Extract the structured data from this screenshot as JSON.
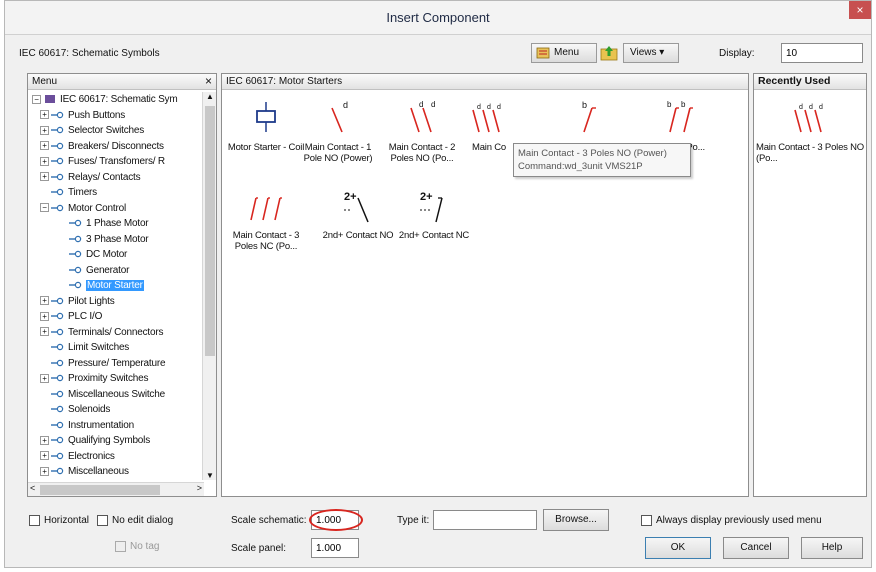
{
  "window": {
    "title": "Insert Component",
    "close_glyph": "×"
  },
  "toolbar": {
    "path": "IEC 60617: Schematic Symbols",
    "menu_label": "Menu",
    "views_label": "Views ▾",
    "display_label": "Display:",
    "display_value": "10"
  },
  "menu_panel": {
    "header": "Menu",
    "close_glyph": "×",
    "tree": [
      {
        "label": "IEC 60617: Schematic Sym",
        "level": 0,
        "expander": "−",
        "icon": "schematic-icon"
      },
      {
        "label": "Push Buttons",
        "level": 1,
        "expander": "+"
      },
      {
        "label": "Selector Switches",
        "level": 1,
        "expander": "+"
      },
      {
        "label": "Breakers/ Disconnects",
        "level": 1,
        "expander": "+"
      },
      {
        "label": "Fuses/ Transfomers/ R",
        "level": 1,
        "expander": "+"
      },
      {
        "label": "Relays/ Contacts",
        "level": 1,
        "expander": "+"
      },
      {
        "label": "Timers",
        "level": 1,
        "expander": ""
      },
      {
        "label": "Motor Control",
        "level": 1,
        "expander": "−"
      },
      {
        "label": "1 Phase Motor",
        "level": 2,
        "expander": ""
      },
      {
        "label": "3 Phase Motor",
        "level": 2,
        "expander": ""
      },
      {
        "label": "DC Motor",
        "level": 2,
        "expander": ""
      },
      {
        "label": "Generator",
        "level": 2,
        "expander": ""
      },
      {
        "label": "Motor Starter",
        "level": 2,
        "expander": "",
        "selected": true
      },
      {
        "label": "Pilot Lights",
        "level": 1,
        "expander": "+"
      },
      {
        "label": "PLC I/O",
        "level": 1,
        "expander": "+"
      },
      {
        "label": "Terminals/ Connectors",
        "level": 1,
        "expander": "+"
      },
      {
        "label": "Limit Switches",
        "level": 1,
        "expander": ""
      },
      {
        "label": "Pressure/ Temperature",
        "level": 1,
        "expander": ""
      },
      {
        "label": "Proximity Switches",
        "level": 1,
        "expander": "+"
      },
      {
        "label": "Miscellaneous Switche",
        "level": 1,
        "expander": ""
      },
      {
        "label": "Solenoids",
        "level": 1,
        "expander": ""
      },
      {
        "label": "Instrumentation",
        "level": 1,
        "expander": ""
      },
      {
        "label": "Qualifying Symbols",
        "level": 1,
        "expander": "+"
      },
      {
        "label": "Electronics",
        "level": 1,
        "expander": "+"
      },
      {
        "label": "Miscellaneous",
        "level": 1,
        "expander": "+"
      }
    ]
  },
  "components_panel": {
    "header": "IEC 60617: Motor Starters",
    "items": [
      {
        "caption": "Motor Starter - Coil",
        "icon": "coil"
      },
      {
        "caption": "Main Contact - 1 Pole NO (Power)",
        "icon": "no-1"
      },
      {
        "caption": "Main Contact - 2 Poles NO (Po...",
        "icon": "no-2"
      },
      {
        "caption": "Main Co",
        "icon": "no-3"
      },
      {
        "caption": "",
        "icon": "nc-1"
      },
      {
        "caption": "ct - 2 Po...",
        "icon": "nc-2"
      },
      {
        "caption": "Main Contact - 3 Poles NC (Po...",
        "icon": "nc-3"
      },
      {
        "caption": "2nd+ Contact NO",
        "icon": "second-no"
      },
      {
        "caption": "2nd+ Contact NC",
        "icon": "second-nc"
      }
    ],
    "tooltip": {
      "line1": "Main Contact - 3 Poles NO (Power)",
      "line2": "Command:wd_3unit VMS21P"
    }
  },
  "recent_panel": {
    "header": "Recently Used",
    "items": [
      {
        "caption": "Main Contact - 3 Poles NO (Po...",
        "icon": "no-3"
      }
    ]
  },
  "bottom": {
    "horizontal_label": "Horizontal",
    "no_edit_label": "No edit dialog",
    "no_tag_label": "No tag",
    "scale_schematic_label": "Scale schematic:",
    "scale_schematic_value": "1.000",
    "scale_panel_label": "Scale panel:",
    "scale_panel_value": "1.000",
    "type_it_label": "Type it:",
    "type_it_value": "",
    "browse_label": "Browse...",
    "always_display_label": "Always display previously used menu",
    "ok_label": "OK",
    "cancel_label": "Cancel",
    "help_label": "Help"
  },
  "colors": {
    "accent": "#3399ff",
    "symbol": "#d8261f",
    "coil": "#1e3a8a",
    "highlight_oval": "#d8261f"
  }
}
